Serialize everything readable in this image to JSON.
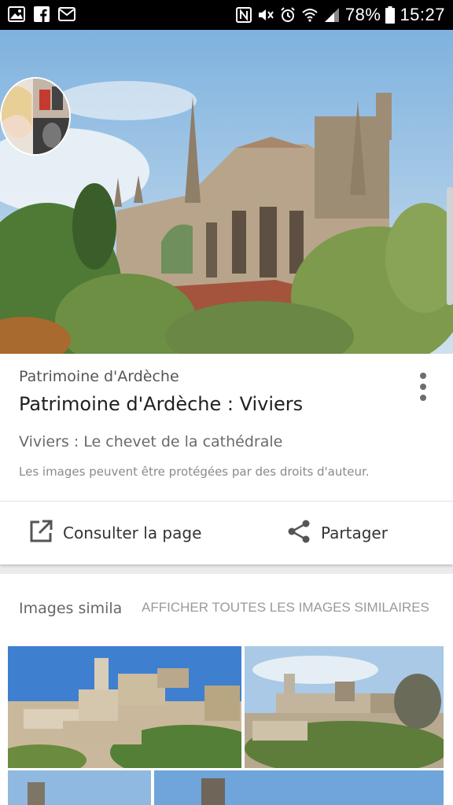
{
  "status_bar": {
    "battery": "78%",
    "time": "15:27",
    "left_icons": [
      "gallery-icon",
      "facebook-icon",
      "mail-icon"
    ],
    "right_icons": [
      "nfc-icon",
      "mute-icon",
      "alarm-icon",
      "wifi-icon",
      "signal-icon",
      "battery-icon"
    ]
  },
  "result": {
    "source": "Patrimoine d'Ardèche",
    "title": "Patrimoine d'Ardèche : Viviers",
    "description": "Viviers : Le chevet de la cathédrale",
    "copyright": "Les images peuvent être protégées par des droits d'auteur."
  },
  "actions": {
    "visit_label": "Consulter la page",
    "share_label": "Partager"
  },
  "similar": {
    "label": "Images simila",
    "view_all": "AFFICHER TOUTES LES IMAGES SIMILAIRES"
  },
  "colors": {
    "status_bar": "#000000",
    "card": "#ffffff",
    "background": "#ebebeb"
  }
}
